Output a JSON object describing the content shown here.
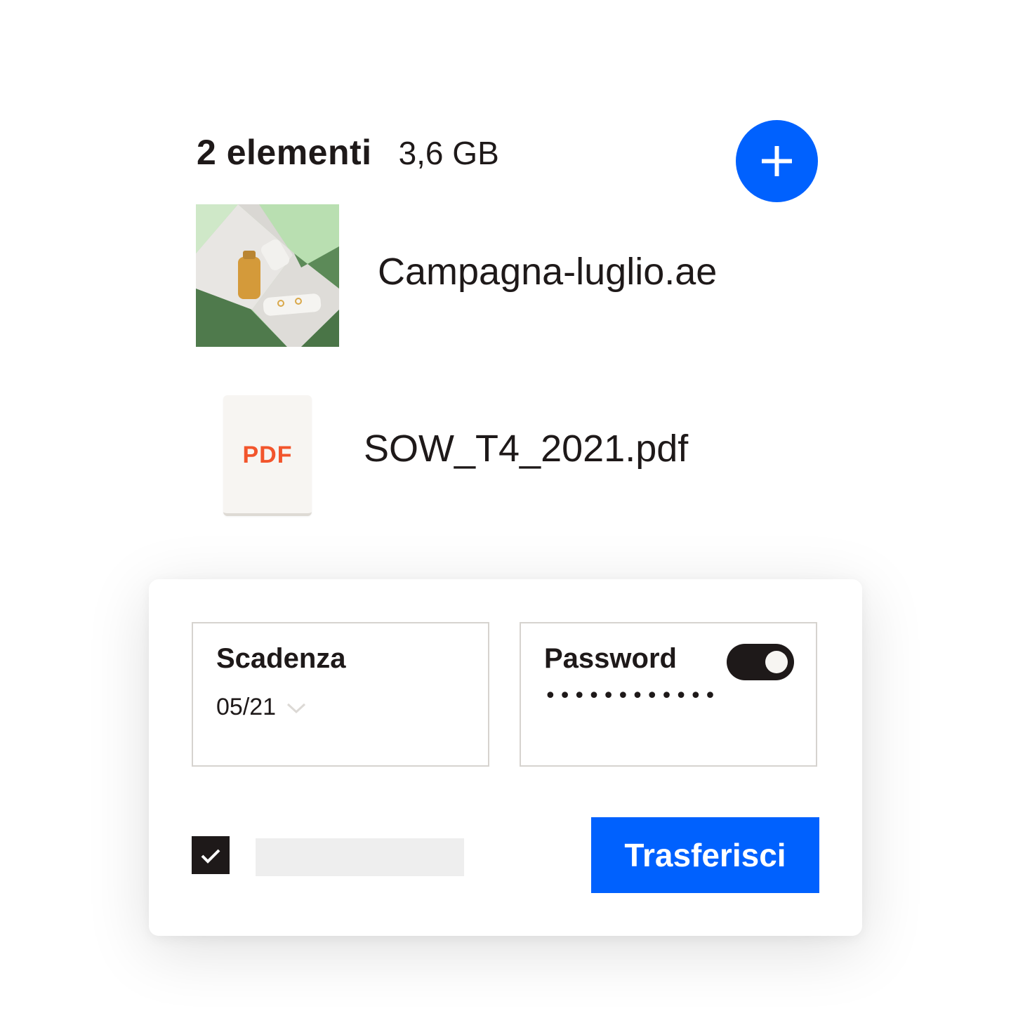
{
  "summary": {
    "count_label": "2 elementi",
    "total_size": "3,6 GB"
  },
  "add_button": {
    "icon": "plus-icon",
    "color": "#0061fe"
  },
  "files": [
    {
      "name": "Campagna-luglio.ae",
      "thumbnail": "image-thumbnail"
    },
    {
      "name": "SOW_T4_2021.pdf",
      "icon_label": "PDF",
      "icon_color": "#f2552c"
    }
  ],
  "transfer_form": {
    "expiry": {
      "label": "Scadenza",
      "value": "05/21"
    },
    "password": {
      "label": "Password",
      "masked_value": "••••••••••••",
      "toggle_on": true
    },
    "checkbox_checked": true,
    "submit_label": "Trasferisci",
    "accent_color": "#0061fe"
  }
}
